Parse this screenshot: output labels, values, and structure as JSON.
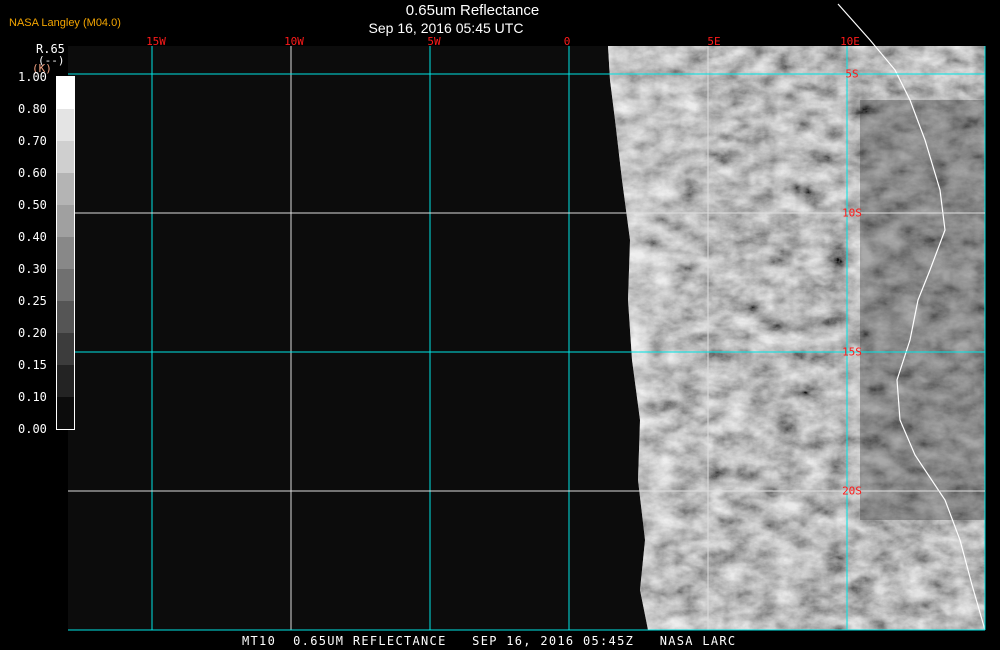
{
  "credit": "NASA Langley (M04.0)",
  "title": "0.65um Reflectance",
  "subtitle": "Sep 16, 2016 05:45 UTC",
  "colorbar": {
    "name": "R.65",
    "units": "(--)",
    "units_alt": "(K)",
    "ticks": [
      "1.00",
      "0.80",
      "0.70",
      "0.60",
      "0.50",
      "0.40",
      "0.30",
      "0.25",
      "0.20",
      "0.15",
      "0.10",
      "0.00"
    ],
    "colors": [
      "#ffffff",
      "#e4e4e4",
      "#cfcfcf",
      "#b4b4b4",
      "#a0a0a0",
      "#888888",
      "#707070",
      "#555555",
      "#3c3c3c",
      "#232323",
      "#0c0c0c"
    ]
  },
  "map": {
    "lon_labels": [
      "15W",
      "10W",
      "5W",
      "0",
      "5E",
      "10E"
    ],
    "lat_labels": [
      "5S",
      "10S",
      "15S",
      "20S"
    ],
    "grid_color": "#00e5e5",
    "label_color": "#ff1a1a"
  },
  "footer": "MT10  0.65UM REFLECTANCE   SEP 16, 2016 05:45Z   NASA LARC"
}
